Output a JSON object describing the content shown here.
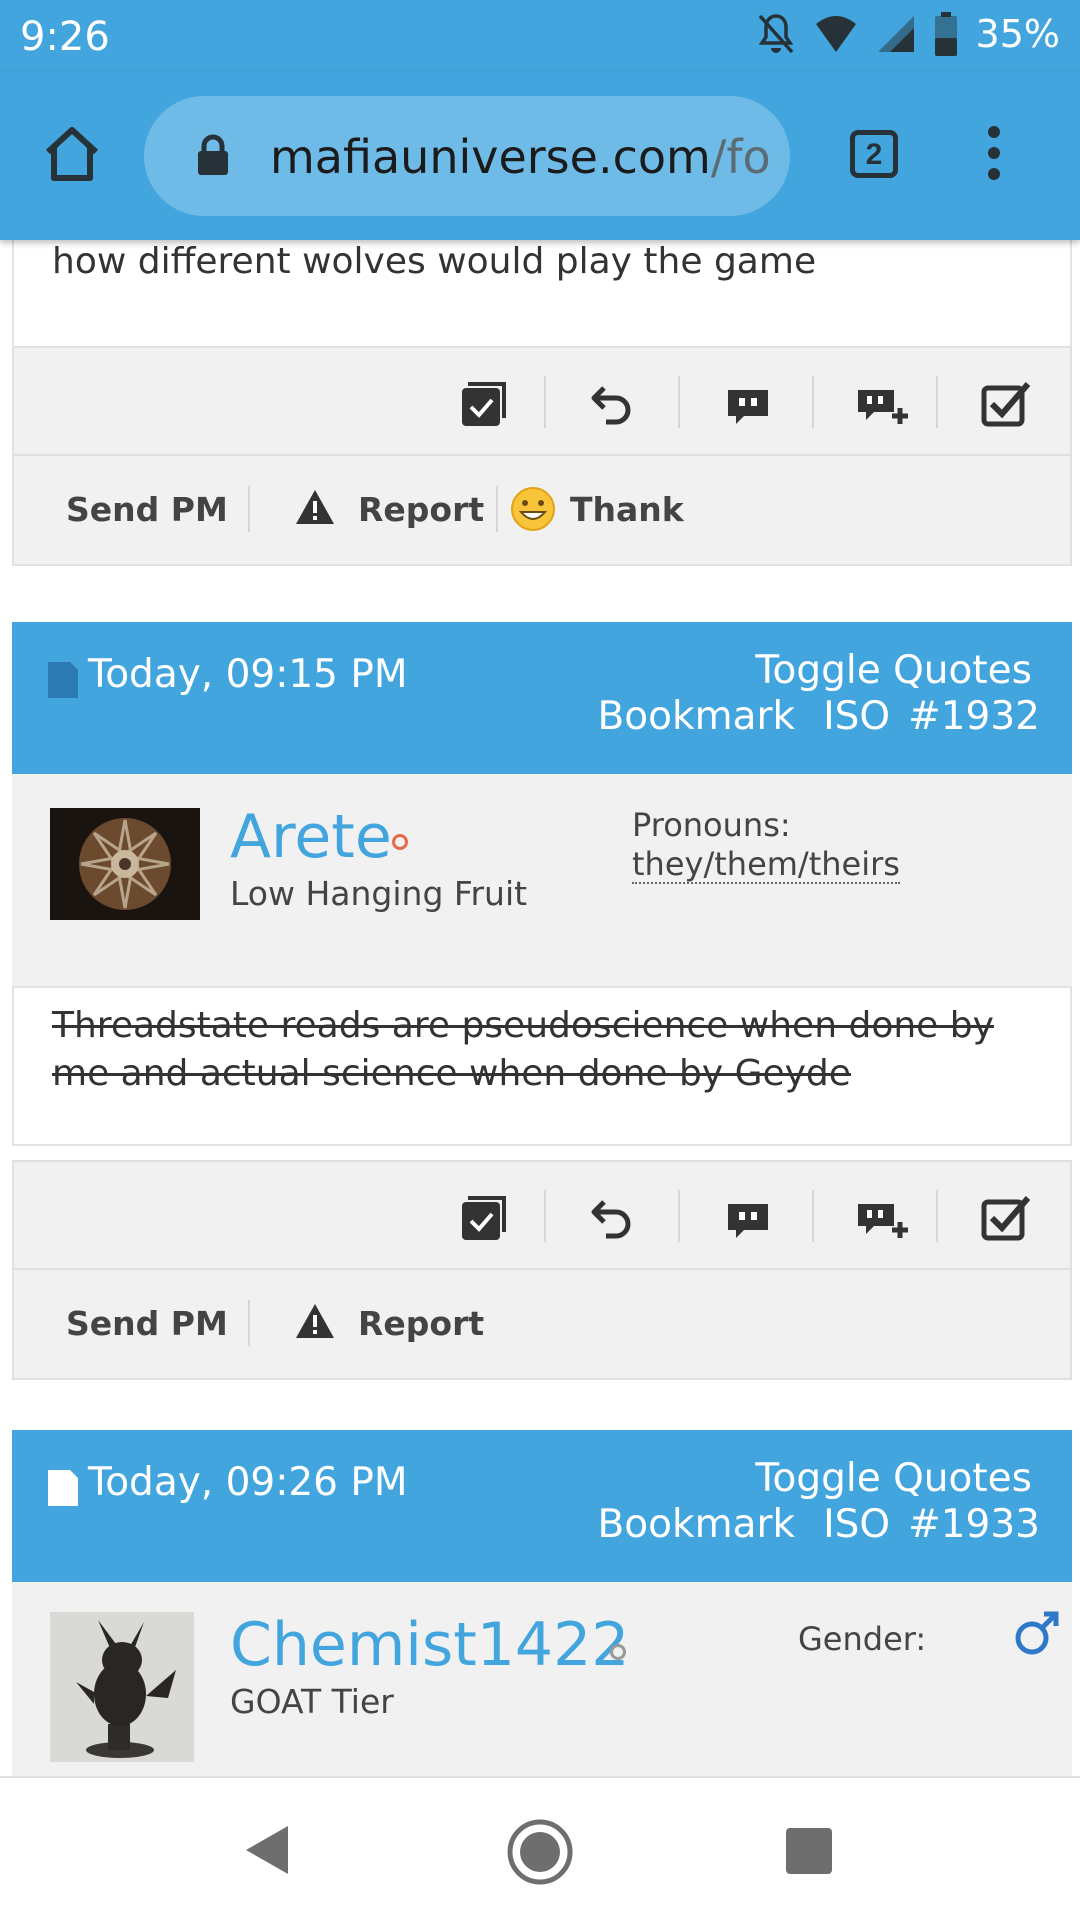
{
  "status_bar": {
    "time": "9:26",
    "battery": "35%"
  },
  "browser": {
    "url_domain": "mafiauniverse.com",
    "url_path": "/foru",
    "tab_count": "2"
  },
  "posts": [
    {
      "body_text": "how different wolves would play the game",
      "footer": {
        "send_pm": "Send PM",
        "report": "Report",
        "thank": "Thank"
      }
    },
    {
      "date": "Today, 09:15 PM",
      "toggle_quotes": "Toggle Quotes",
      "bookmark": "Bookmark",
      "iso": "ISO",
      "number": "#1932",
      "username": "Arete",
      "user_title": "Low Hanging Fruit",
      "field_label": "Pronouns:",
      "field_value": "they/them/theirs",
      "body_line1": "Threadstate reads are pseudoscience when done by",
      "body_line2": "me and actual science when done by Geyde",
      "footer": {
        "send_pm": "Send PM",
        "report": "Report"
      }
    },
    {
      "date": "Today, 09:26 PM",
      "toggle_quotes": "Toggle Quotes",
      "bookmark": "Bookmark",
      "iso": "ISO",
      "number": "#1933",
      "username": "Chemist1422",
      "user_title": "GOAT Tier",
      "field_label": "Gender:",
      "field_icon": "male-symbol-icon"
    }
  ],
  "colors": {
    "brand_blue": "#42a5de",
    "offline_dot": "#e66a4a"
  }
}
